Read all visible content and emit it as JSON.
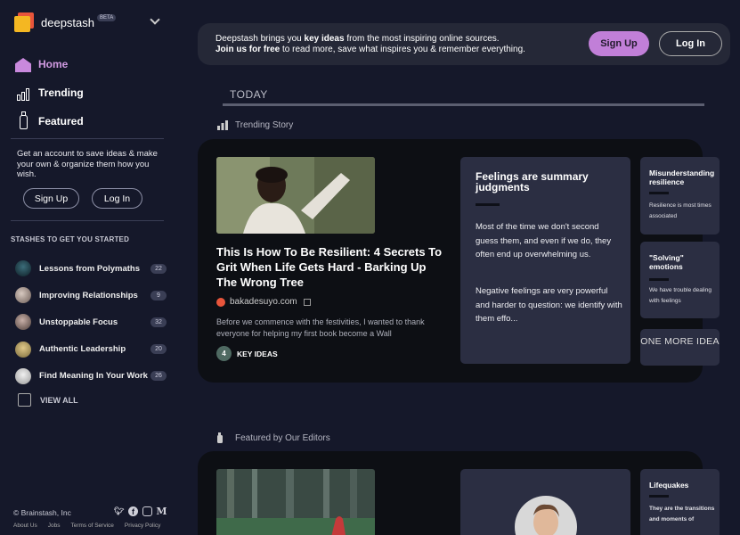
{
  "brand": {
    "name": "deepstash",
    "badge": "BETA"
  },
  "nav": [
    {
      "label": "Home",
      "icon": "home-icon",
      "active": true
    },
    {
      "label": "Trending",
      "icon": "trending-icon",
      "active": false
    },
    {
      "label": "Featured",
      "icon": "bottle-icon",
      "active": false
    }
  ],
  "promo": {
    "text": "Get an account to save ideas & make your own & organize them how you wish.",
    "signup": "Sign Up",
    "login": "Log In"
  },
  "stashes": {
    "heading": "STASHES TO GET YOU STARTED",
    "items": [
      {
        "name": "Lessons from Polymaths",
        "count": "22"
      },
      {
        "name": "Improving Relationships",
        "count": "9"
      },
      {
        "name": "Unstoppable Focus",
        "count": "32"
      },
      {
        "name": "Authentic Leadership",
        "count": "20"
      },
      {
        "name": "Find Meaning In Your Work",
        "count": "26"
      }
    ],
    "view_all": "VIEW ALL"
  },
  "footer": {
    "copyright": "© Brainstash, Inc",
    "links": [
      "About Us",
      "Jobs",
      "Terms of Service",
      "Privacy Policy"
    ],
    "socials": [
      "twitter-icon",
      "facebook-icon",
      "instagram-icon",
      "medium-icon"
    ]
  },
  "banner": {
    "line1_pre": "Deepstash brings you ",
    "line1_bold": "key ideas",
    "line1_post": " from the most inspiring online sources.",
    "line2_bold": "Join us for free",
    "line2_post": " to read more, save what inspires you & remember everything.",
    "signup": "Sign Up",
    "login": "Log In"
  },
  "today": "TODAY",
  "trending": {
    "label": "Trending Story",
    "title": "This Is How To Be Resilient: 4 Secrets To Grit When Life Gets Hard - Barking Up The Wrong Tree",
    "source": "bakadesuyo.com",
    "excerpt": "Before we commence with the festivities, I wanted to thank everyone for helping my first book become a Wall",
    "key_ideas_count": "4",
    "key_ideas_label": "KEY IDEAS",
    "idea_main": {
      "title": "Feelings are summary judgments",
      "p1": "Most of the time we don't second guess them, and even if we do, they often end up overwhelming us.",
      "p2": "Negative feelings are very powerful and harder to question: we identify with them effo..."
    },
    "idea_2": {
      "title": "Misunderstanding resilience",
      "text": "Resilience is most times associated"
    },
    "idea_3": {
      "title": "\"Solving\" emotions",
      "text": "We have trouble dealing with feelings"
    },
    "more": "ONE MORE IDEA"
  },
  "featured": {
    "label": "Featured by Our Editors",
    "idea_2": {
      "title": "Lifequakes",
      "text": "They are the transitions and moments of"
    }
  }
}
